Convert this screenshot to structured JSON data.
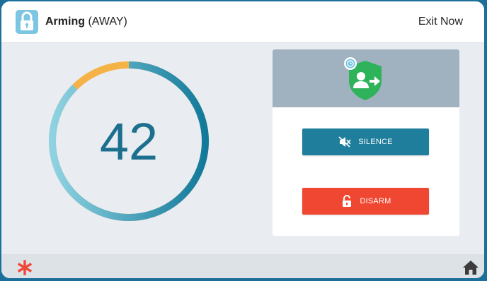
{
  "header": {
    "title_bold": "Arming",
    "title_mode": "(AWAY)",
    "exit_label": "Exit Now",
    "lock_icon": "lock-icon"
  },
  "countdown": {
    "value": "42",
    "progress_fraction": 0.875,
    "colors": {
      "elapsed_track": "#f5b347",
      "ring_start": "#8fd3e2",
      "ring_end": "#12799a"
    }
  },
  "panel": {
    "status_icon": "away-arming-shield-icon",
    "silence_label": "SILENCE",
    "silence_icon": "speaker-mute-icon",
    "disarm_label": "DISARM",
    "disarm_icon": "unlock-icon"
  },
  "footer": {
    "left_icon": "asterisk-icon",
    "right_icon": "home-icon"
  },
  "colors": {
    "border": "#1b6f99",
    "silence_button": "#1f7e9c",
    "disarm_button": "#ef4731",
    "shield_green": "#2eb25a",
    "panel_header": "#a0b1bf"
  }
}
